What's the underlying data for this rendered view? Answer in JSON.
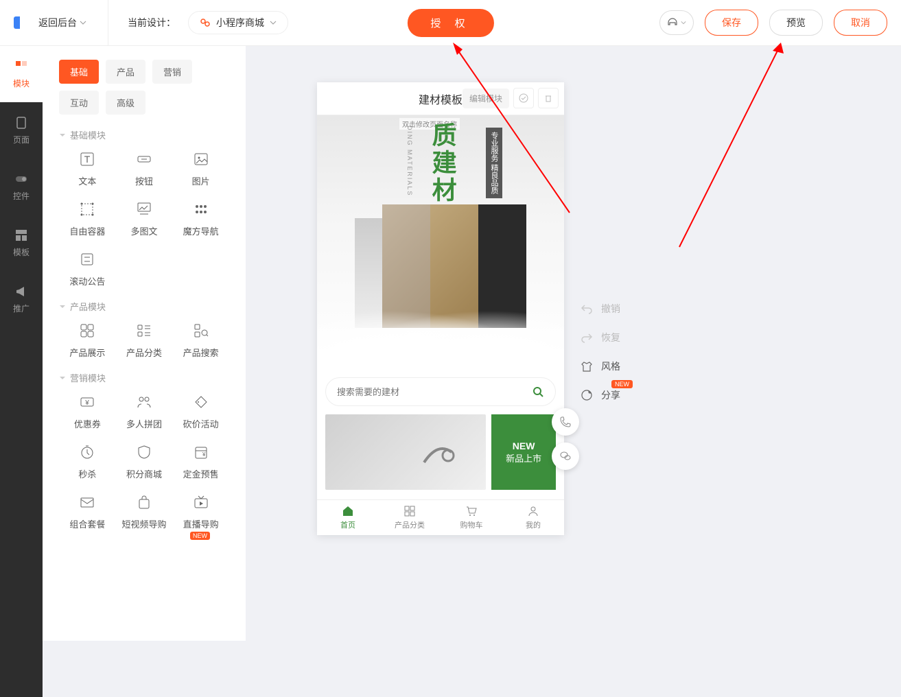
{
  "header": {
    "back": "返回后台",
    "design_label": "当前设计：",
    "design_value": "小程序商城",
    "auth": "授 权",
    "save": "保存",
    "preview": "预览",
    "cancel": "取消"
  },
  "left_nav": {
    "items": [
      {
        "label": "模块"
      },
      {
        "label": "页面"
      },
      {
        "label": "控件"
      },
      {
        "label": "模板"
      },
      {
        "label": "推广"
      }
    ]
  },
  "module_panel": {
    "tabs": [
      "基础",
      "产品",
      "营销",
      "互动",
      "高级"
    ],
    "sections": [
      {
        "title": "基础模块",
        "items": [
          "文本",
          "按钮",
          "图片",
          "自由容器",
          "多图文",
          "魔方导航",
          "滚动公告"
        ]
      },
      {
        "title": "产品模块",
        "items": [
          "产品展示",
          "产品分类",
          "产品搜索"
        ]
      },
      {
        "title": "营销模块",
        "items": [
          "优惠券",
          "多人拼团",
          "砍价活动",
          "秒杀",
          "积分商城",
          "定金预售",
          "组合套餐",
          "短视频导购",
          "直播导购"
        ]
      }
    ],
    "new_label": "NEW"
  },
  "preview": {
    "title": "建材模板",
    "edit_module": "编辑模块",
    "page_name_hint": "双击修改页面名称",
    "banner_main": "质建材",
    "banner_sub": "专业服务 精良品质",
    "banner_eng": "DING MATERIALS",
    "search_placeholder": "搜索需要的建材",
    "promo_new": "NEW",
    "promo_new_sub": "新品上市",
    "tabbar": [
      "首页",
      "产品分类",
      "购物车",
      "我的"
    ]
  },
  "right_tools": {
    "undo": "撤销",
    "redo": "恢复",
    "style": "风格",
    "share": "分享",
    "new_label": "NEW"
  }
}
